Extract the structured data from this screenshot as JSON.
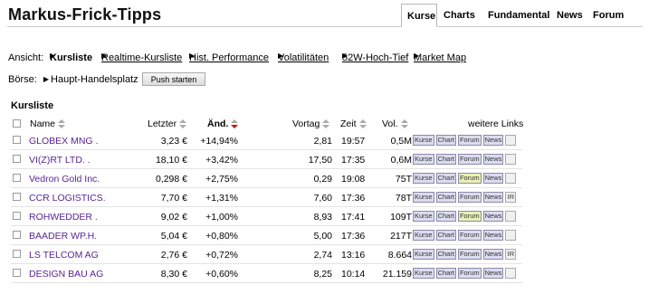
{
  "header": {
    "site_title": "Markus-Frick-Tipps",
    "nav": [
      {
        "label": "Kurse",
        "active": true
      },
      {
        "label": "Charts",
        "active": false
      },
      {
        "label": "Fundamental",
        "active": false
      },
      {
        "label": "News",
        "active": false
      },
      {
        "label": "Forum",
        "active": false
      }
    ]
  },
  "view_bar": {
    "prefix": "Ansicht:",
    "items": [
      {
        "label": "Kursliste",
        "current": true
      },
      {
        "label": "Realtime-Kursliste",
        "current": false
      },
      {
        "label": "Hist. Performance",
        "current": false
      },
      {
        "label": "Volatilitäten",
        "current": false
      },
      {
        "label": "52W-Hoch-Tief",
        "current": false
      },
      {
        "label": "Market Map",
        "current": false
      }
    ]
  },
  "exchange": {
    "label": "Börse:",
    "value": "Haupt-Handelsplatz",
    "push_button": "Push starten"
  },
  "table": {
    "title": "Kursliste",
    "columns": {
      "name": "Name",
      "letzter": "Letzter",
      "aend": "Änd.",
      "vortag": "Vortag",
      "zeit": "Zeit",
      "vol": "Vol.",
      "links": "weitere Links"
    },
    "link_labels": {
      "kurse": "Kurse",
      "chart": "Chart",
      "forum": "Forum",
      "news": "News",
      "ir": "IR"
    },
    "rows": [
      {
        "name": "GLOBEX MNG .",
        "letzter": "3,23 €",
        "aend": "+14,94%",
        "vortag": "2,81",
        "zeit": "19:57",
        "vol": "0,5M",
        "forum_hi": false,
        "ir": false
      },
      {
        "name": "VI(Z)RT LTD. .",
        "letzter": "18,10 €",
        "aend": "+3,42%",
        "vortag": "17,50",
        "zeit": "17:35",
        "vol": "0,6M",
        "forum_hi": false,
        "ir": false
      },
      {
        "name": "Vedron Gold Inc.",
        "letzter": "0,298 €",
        "aend": "+2,75%",
        "vortag": "0,29",
        "zeit": "19:08",
        "vol": "75T",
        "forum_hi": true,
        "ir": false
      },
      {
        "name": "CCR LOGISTICS.",
        "letzter": "7,70 €",
        "aend": "+1,31%",
        "vortag": "7,60",
        "zeit": "17:36",
        "vol": "78T",
        "forum_hi": false,
        "ir": true
      },
      {
        "name": "ROHWEDDER .",
        "letzter": "9,02 €",
        "aend": "+1,00%",
        "vortag": "8,93",
        "zeit": "17:41",
        "vol": "109T",
        "forum_hi": true,
        "ir": false
      },
      {
        "name": "BAADER WP.H.",
        "letzter": "5,04 €",
        "aend": "+0,80%",
        "vortag": "5,00",
        "zeit": "17:36",
        "vol": "217T",
        "forum_hi": false,
        "ir": false
      },
      {
        "name": "LS TELCOM AG",
        "letzter": "2,76 €",
        "aend": "+0,72%",
        "vortag": "2,74",
        "zeit": "13:16",
        "vol": "8.664",
        "forum_hi": false,
        "ir": true
      },
      {
        "name": "DESIGN BAU AG",
        "letzter": "8,30 €",
        "aend": "+0,60%",
        "vortag": "8,25",
        "zeit": "10:14",
        "vol": "21.159",
        "forum_hi": false,
        "ir": false
      }
    ]
  }
}
